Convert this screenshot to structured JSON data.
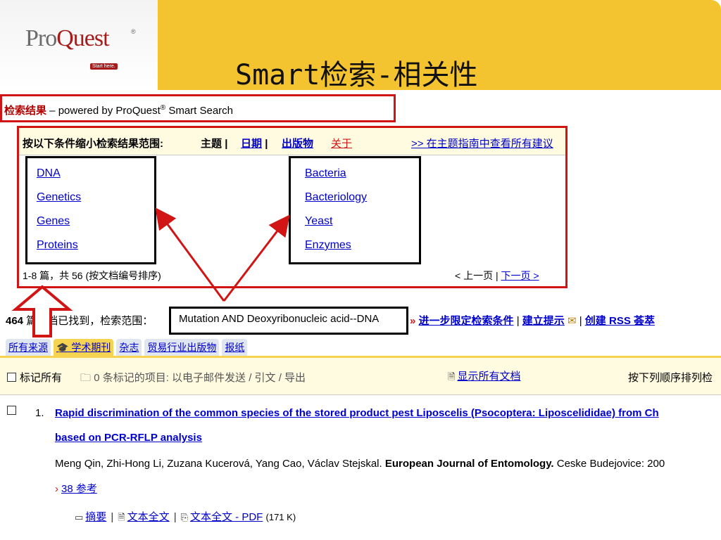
{
  "slide": {
    "title": "Smart检索-相关性",
    "logo": {
      "pro": "Pro",
      "quest": "Quest",
      "reg": "®",
      "tagline": "Start here."
    }
  },
  "results_header": {
    "label": "检索结果",
    "powered": " – powered by ProQuest",
    "reg": "®",
    "smart": " Smart Search"
  },
  "refine": {
    "label": "按以下条件缩小检索结果范围:",
    "topic": "主题",
    "sep1": "|",
    "date": "日期",
    "sep2": "|",
    "pub": "出版物",
    "about": "关于",
    "all_suggestions": ">> 在主题指南中查看所有建议",
    "terms_left": [
      "DNA",
      "Genetics",
      "Genes",
      "Proteins"
    ],
    "terms_right": [
      "Bacteria",
      "Bacteriology",
      "Yeast",
      "Enzymes"
    ],
    "page_info": "1-8 篇，共 56 (按文档编号排序)",
    "prev": "< 上一页",
    "nav_sep": "|",
    "next": "下一页 >"
  },
  "search": {
    "count": "464",
    "count_text": " 篇文档已找到，检索范围：",
    "query": "Mutation AND Deoxyribonucleic acid--DNA",
    "refine_more_arrow": "»",
    "refine_more": "进一步限定检索条件",
    "sep1": "|",
    "tip": "建立提示",
    "mail_icon": "✉",
    "sep2": "|",
    "create": "创建",
    "rss": "RSS 荟萃"
  },
  "tabs": [
    "所有来源",
    "学术期刊",
    "杂志",
    "贸易行业出版物",
    "报纸"
  ],
  "toolbar": {
    "mark_all": "标记所有",
    "marked": "0 条标记的项目: 以电子邮件发送 / 引文 / 导出",
    "show_all": "显示所有文档",
    "sort": "按下列顺序排列检"
  },
  "result": {
    "number": "1.",
    "title_line1": "Rapid discrimination of the common species of the stored product pest Liposcelis (Psocoptera: Liposcelididae) from Ch",
    "title_line2": "based on PCR-RFLP analysis",
    "authors": "Meng Qin, Zhi-Hong Li, Zuzana Kucerová, Yang Cao, Václav Stejskal.",
    "journal": "European Journal of Entomology.",
    "place": " Ceske Budejovice: 200",
    "refs": "38 参考",
    "abstract": "摘要",
    "fulltext": "文本全文",
    "fulltext_pdf": "文本全文 - PDF",
    "pdf_size": "(171 K)"
  },
  "colors": {
    "highlight_red": "#d11414",
    "header_yellow": "#f4c430",
    "link_blue": "#0000cc"
  }
}
